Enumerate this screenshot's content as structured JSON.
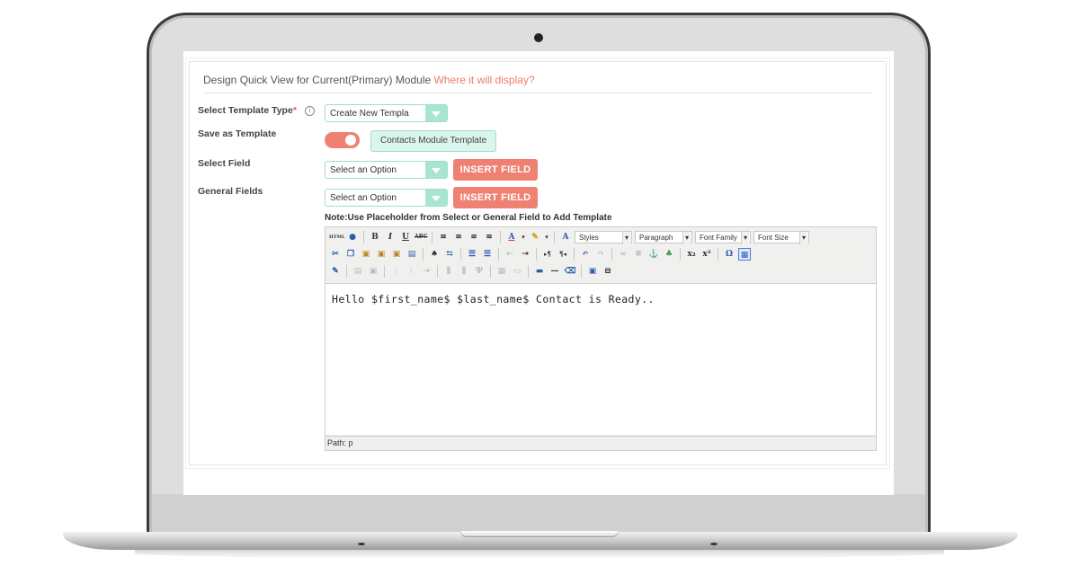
{
  "panel": {
    "heading": "Design Quick View for Current(Primary) Module",
    "heading_link": "Where it will display?"
  },
  "form": {
    "template_type": {
      "label": "Select Template Type",
      "required_mark": "*",
      "info_icon": "i",
      "value": "Create New Templa"
    },
    "save_as_template": {
      "label": "Save as Template",
      "toggle_on": true,
      "template_name": "Contacts Module Template"
    },
    "select_field": {
      "label": "Select Field",
      "value": "Select an Option",
      "button": "INSERT FIELD"
    },
    "general_fields": {
      "label": "General Fields",
      "value": "Select an Option",
      "button": "INSERT FIELD"
    },
    "note": "Note:Use Placeholder from Select or General Field to Add Template"
  },
  "editor": {
    "toolbar": {
      "html": "HTML",
      "bold": "B",
      "italic": "I",
      "underline": "U",
      "strike": "ABC",
      "styles": "Styles",
      "paragraph": "Paragraph",
      "font_family": "Font Family",
      "font_size": "Font Size",
      "subscript": "x₂",
      "superscript": "x²",
      "omega": "Ω"
    },
    "content": "Hello $first_name$ $last_name$ Contact is Ready..",
    "path": "Path: p"
  },
  "colors": {
    "accent_coral": "#ef8173",
    "accent_mint": "#a8e6d2"
  }
}
